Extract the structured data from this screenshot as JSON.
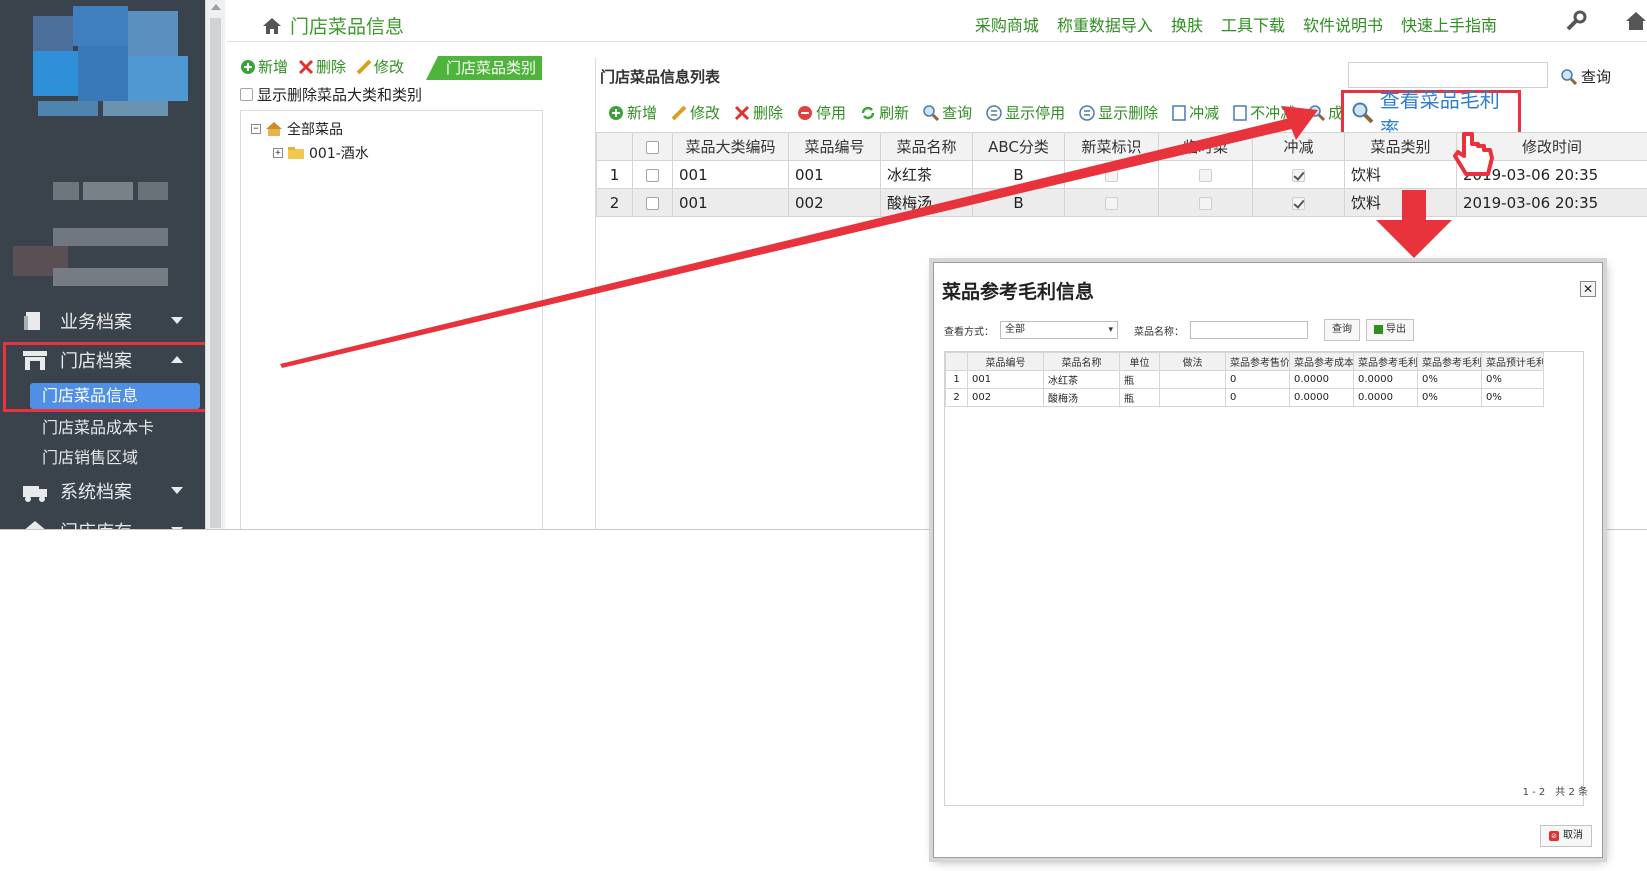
{
  "sidebar": {
    "menus": [
      {
        "label": "业务档案",
        "icon": "document-icon",
        "expanded": false
      },
      {
        "label": "门店档案",
        "icon": "store-icon",
        "expanded": true
      },
      {
        "label": "系统档案",
        "icon": "truck-icon",
        "expanded": false
      },
      {
        "label": "门店库存",
        "icon": "home-icon",
        "expanded": false
      }
    ],
    "store_items": [
      "门店菜品信息",
      "门店菜品成本卡",
      "门店销售区域"
    ],
    "active_item": "门店菜品信息"
  },
  "topbar": {
    "page_title": "门店菜品信息",
    "links": [
      "采购商城",
      "称重数据导入",
      "换肤",
      "工具下载",
      "软件说明书",
      "快速上手指南"
    ]
  },
  "left_pane": {
    "toolbar": [
      "新增",
      "删除",
      "修改"
    ],
    "tab": "门店菜品类别",
    "show_deleted_label": "显示删除菜品大类和类别",
    "tree": {
      "root": "全部菜品",
      "child": "001-酒水"
    }
  },
  "right_pane": {
    "title": "门店菜品信息列表",
    "search_label": "查询",
    "toolbar": [
      "新增",
      "修改",
      "删除",
      "停用",
      "刷新",
      "查询",
      "显示停用",
      "显示删除",
      "冲减",
      "不冲减",
      "成本卡"
    ],
    "view_margin_label": "查看菜品毛利率",
    "columns": [
      "菜品大类编码",
      "菜品编号",
      "菜品名称",
      "ABC分类",
      "新菜标识",
      "临时菜",
      "冲减",
      "菜品类别",
      "修改时间"
    ],
    "rows": [
      {
        "no": "1",
        "cat_code": "001",
        "code": "001",
        "name": "冰红茶",
        "abc": "B",
        "new": false,
        "temp": false,
        "offset": true,
        "type": "饮料",
        "time": "2019-03-06 20:35"
      },
      {
        "no": "2",
        "cat_code": "001",
        "code": "002",
        "name": "酸梅汤",
        "abc": "B",
        "new": false,
        "temp": false,
        "offset": true,
        "type": "饮料",
        "time": "2019-03-06 20:35"
      }
    ]
  },
  "modal": {
    "title": "菜品参考毛利信息",
    "view_mode_label": "查看方式：",
    "view_mode_value": "全部",
    "name_label": "菜品名称：",
    "query_button": "查询",
    "export_button": "导出",
    "columns": [
      "菜品编号",
      "菜品名称",
      "单位",
      "做法",
      "菜品参考售价",
      "菜品参考成本",
      "菜品参考毛利",
      "菜品参考毛利率",
      "菜品预计毛利率"
    ],
    "rows": [
      [
        "1",
        "001",
        "冰红茶",
        "瓶",
        "",
        "0",
        "0.0000",
        "0.0000",
        "0%",
        "0%"
      ],
      [
        "2",
        "002",
        "酸梅汤",
        "瓶",
        "",
        "0",
        "0.0000",
        "0.0000",
        "0%",
        "0%"
      ]
    ],
    "pager": "1 - 2　共 2 条",
    "cancel_button": "取消"
  },
  "colors": {
    "accent_green": "#2f8f21",
    "highlight_red": "#e8333c",
    "sidebar_bg": "#3a424b",
    "active_blue": "#4f8fe6"
  }
}
